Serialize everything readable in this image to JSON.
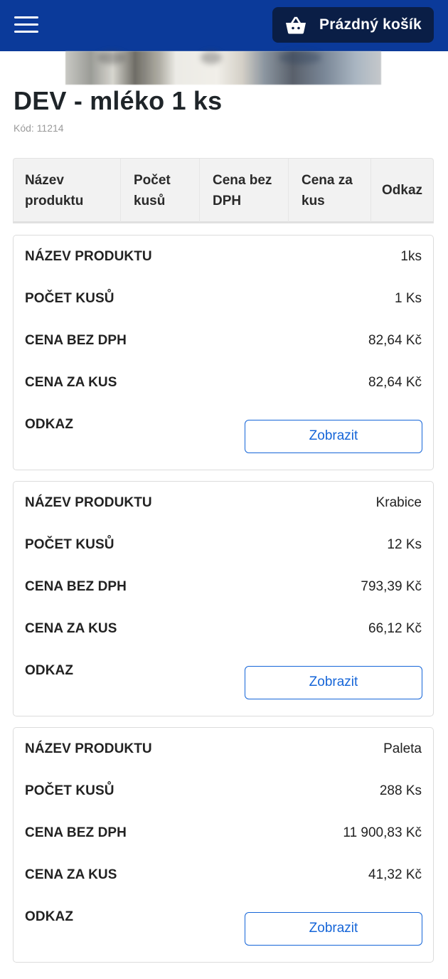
{
  "header": {
    "cart_label": "Prázdný košík",
    "menu_icon": "hamburger-icon",
    "cart_icon": "basket-icon"
  },
  "product": {
    "title": "DEV - mléko 1 ks",
    "code": "Kód: 11214"
  },
  "table": {
    "columns": [
      [
        "Název",
        "produktu"
      ],
      [
        "Počet",
        "kusů"
      ],
      [
        "Cena bez",
        "DPH"
      ],
      [
        "Cena za",
        "kus"
      ],
      [
        "Odkaz"
      ]
    ],
    "row_labels": {
      "name": "NÁZEV PRODUKTU",
      "count": "POČET KUSŮ",
      "price_no_vat": "CENA BEZ DPH",
      "unit_price": "CENA ZA KUS",
      "link": "ODKAZ"
    },
    "rows": [
      {
        "name": "1ks",
        "count": "1 Ks",
        "price_no_vat": "82,64 Kč",
        "unit_price": "82,64 Kč",
        "link_label": "Zobrazit"
      },
      {
        "name": "Krabice",
        "count": "12 Ks",
        "price_no_vat": "793,39 Kč",
        "unit_price": "66,12 Kč",
        "link_label": "Zobrazit"
      },
      {
        "name": "Paleta",
        "count": "288 Ks",
        "price_no_vat": "11 900,83 Kč",
        "unit_price": "41,32 Kč",
        "link_label": "Zobrazit"
      }
    ]
  },
  "colors": {
    "header_bg": "#0b3a9a",
    "cart_bg": "#0a1e46",
    "link_blue": "#1565d8"
  }
}
